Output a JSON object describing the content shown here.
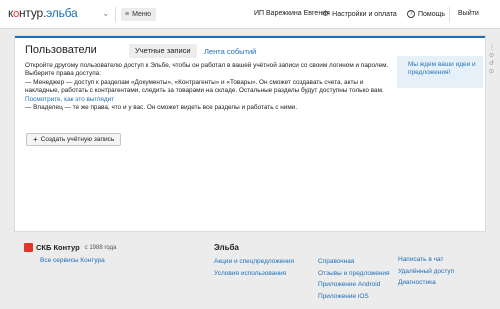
{
  "header": {
    "logo_prefix": "к",
    "logo_o": "о",
    "logo_rest": "нтур",
    "logo_dot": ".",
    "logo_product": "эльба",
    "logo_arrow": "⌄",
    "menu_icon": "≡",
    "menu_label": "Меню",
    "user_name": "ИП Варежкина Евгения",
    "settings_icon": "⚙",
    "settings_label": "Настройки и оплата",
    "help_icon": "?",
    "help_label": "Помощь",
    "logout_label": "Выйти"
  },
  "page": {
    "title": "Пользователи",
    "tabs": [
      "Учетные записи",
      "Лента событий"
    ],
    "intro": "Откройте другому пользователю доступ к Эльбе, чтобы он работал в вашей учётной записи со своим логином и паролем.",
    "choose": "Выберите права доступа:",
    "manager": "— Менеджер — доступ к разделам «Документы», «Контрагенты» и «Товары». Он сможет создавать счета, акты и накладные, работать с контрагентами, следить за товарами на складе. Остальные разделы будут доступны только вам.",
    "manager_link": "Посмотрите, как это выглядит",
    "owner": "— Владелец — те же права, что и у вас. Он сможет видеть все разделы и работать с ними.",
    "create_plus": "+",
    "create_label": "Создать учётную запись",
    "promo": "Мы ждем ваши идеи и предложения!"
  },
  "side_icons": [
    "⋮",
    "⊙",
    "↺",
    "⊙"
  ],
  "footer": {
    "company": "СКБ Контур",
    "since": "с 1988 года",
    "services_link": "Все сервисы Контура",
    "product_title": "Эльба",
    "col1": [
      "Акции и спецпредложения",
      "Условия использования"
    ],
    "col2": [
      "Справочная",
      "Отзывы и предложения",
      "Приложение Android",
      "Приложение iOS"
    ],
    "col3": [
      "Написать в чат",
      "Удалённый доступ",
      "Диагностика"
    ]
  },
  "colors": {
    "accent": "#1f6fb8",
    "brand_red": "#e2342a",
    "promo_bg": "#e6f0f8",
    "page_bg": "#ececec"
  }
}
